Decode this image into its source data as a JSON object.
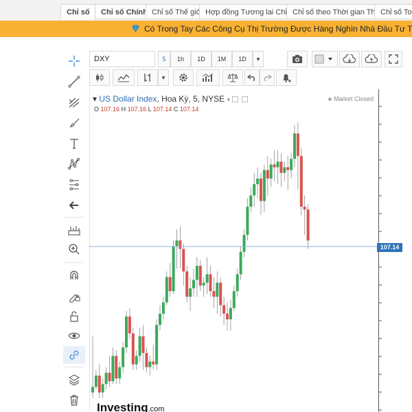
{
  "nav": {
    "tabs": [
      {
        "label": "Chỉ số"
      },
      {
        "label": "Chỉ số Chính"
      },
      {
        "label": "Chỉ số Thế giới"
      },
      {
        "label": "Hợp đồng Tương lai Chỉ số"
      },
      {
        "label": "Chỉ số theo Thời gian Thực"
      },
      {
        "label": "Chỉ số Toàn"
      }
    ]
  },
  "promo": {
    "text": "Có Trong Tay Các Công Cụ Thị Trường Được Hàng Nghìn Nhà Đầu Tư Tin Tưởng"
  },
  "toolbar": {
    "symbol": "DXY",
    "intervals": [
      "5",
      "1h",
      "1D",
      "1M",
      "1D"
    ],
    "dropdown_caret": "▾"
  },
  "left_tools": [
    {
      "icon": "crosshair-icon"
    },
    {
      "icon": "trendline-icon"
    },
    {
      "icon": "pitchfork-icon"
    },
    {
      "icon": "brush-icon"
    },
    {
      "icon": "text-icon"
    },
    {
      "icon": "pattern-icon"
    },
    {
      "icon": "fib-icon"
    },
    {
      "icon": "arrow-left-icon"
    },
    {
      "icon": "measure-icon"
    },
    {
      "icon": "zoom-in-icon"
    },
    {
      "icon": "magnet-icon"
    },
    {
      "icon": "lock-drawing-icon"
    },
    {
      "icon": "unlock-icon"
    },
    {
      "icon": "eye-icon"
    },
    {
      "icon": "link-icon"
    },
    {
      "icon": "layers-icon"
    },
    {
      "icon": "trash-icon"
    }
  ],
  "chart": {
    "symbol": "US Dollar Index",
    "details": ", Hoa Kỳ, 5, NYSE",
    "ohlc": {
      "o_label": "O",
      "o": "107.16",
      "h_label": "H",
      "h": "107.16",
      "l_label": "L",
      "l": "107.14",
      "c_label": "C",
      "c": "107.14"
    },
    "status": "Market Closed",
    "last_price": "107.14",
    "watermark": "Investing",
    "watermark_suffix": ".com",
    "colors": {
      "up": "#3aaa5c",
      "down": "#d9534f",
      "price_line": "#2e73b8"
    }
  },
  "chart_data": {
    "type": "candlestick",
    "symbol": "DXY",
    "interval": "5",
    "last_price": 107.14,
    "candles_note": "shape",
    "candles": [
      [
        0.04,
        0.24,
        0.06,
        0.02
      ],
      [
        0.06,
        0.12,
        0.1,
        0.05
      ],
      [
        0.1,
        0.14,
        0.04,
        0.02
      ],
      [
        0.04,
        0.09,
        0.07,
        0.02
      ],
      [
        0.07,
        0.13,
        0.11,
        0.05
      ],
      [
        0.11,
        0.17,
        0.08,
        0.06
      ],
      [
        0.08,
        0.2,
        0.17,
        0.07
      ],
      [
        0.17,
        0.19,
        0.09,
        0.07
      ],
      [
        0.09,
        0.15,
        0.13,
        0.07
      ],
      [
        0.13,
        0.22,
        0.2,
        0.11
      ],
      [
        0.2,
        0.33,
        0.31,
        0.18
      ],
      [
        0.31,
        0.34,
        0.25,
        0.23
      ],
      [
        0.25,
        0.27,
        0.14,
        0.12
      ],
      [
        0.14,
        0.19,
        0.17,
        0.12
      ],
      [
        0.17,
        0.27,
        0.24,
        0.15
      ],
      [
        0.24,
        0.28,
        0.18,
        0.12
      ],
      [
        0.18,
        0.2,
        0.13,
        0.11
      ],
      [
        0.13,
        0.17,
        0.15,
        0.1
      ],
      [
        0.15,
        0.21,
        0.14,
        0.12
      ],
      [
        0.14,
        0.3,
        0.28,
        0.12
      ],
      [
        0.28,
        0.35,
        0.32,
        0.26
      ],
      [
        0.32,
        0.38,
        0.36,
        0.3
      ],
      [
        0.36,
        0.47,
        0.45,
        0.35
      ],
      [
        0.45,
        0.5,
        0.4,
        0.38
      ],
      [
        0.4,
        0.58,
        0.56,
        0.39
      ],
      [
        0.56,
        0.62,
        0.58,
        0.48
      ],
      [
        0.58,
        0.63,
        0.55,
        0.48
      ],
      [
        0.55,
        0.57,
        0.47,
        0.42
      ],
      [
        0.47,
        0.49,
        0.38,
        0.36
      ],
      [
        0.38,
        0.45,
        0.41,
        0.33
      ],
      [
        0.41,
        0.48,
        0.44,
        0.38
      ],
      [
        0.44,
        0.52,
        0.49,
        0.38
      ],
      [
        0.49,
        0.51,
        0.42,
        0.4
      ],
      [
        0.42,
        0.45,
        0.43,
        0.38
      ],
      [
        0.43,
        0.52,
        0.46,
        0.39
      ],
      [
        0.46,
        0.49,
        0.4,
        0.38
      ],
      [
        0.4,
        0.45,
        0.38,
        0.34
      ],
      [
        0.38,
        0.47,
        0.43,
        0.32
      ],
      [
        0.43,
        0.45,
        0.35,
        0.31
      ],
      [
        0.35,
        0.38,
        0.32,
        0.28
      ],
      [
        0.32,
        0.36,
        0.3,
        0.26
      ],
      [
        0.3,
        0.37,
        0.34,
        0.26
      ],
      [
        0.34,
        0.42,
        0.4,
        0.33
      ],
      [
        0.4,
        0.48,
        0.46,
        0.38
      ],
      [
        0.46,
        0.56,
        0.54,
        0.44
      ],
      [
        0.54,
        0.62,
        0.6,
        0.52
      ],
      [
        0.6,
        0.73,
        0.7,
        0.58
      ],
      [
        0.7,
        0.77,
        0.74,
        0.68
      ],
      [
        0.74,
        0.82,
        0.78,
        0.7
      ],
      [
        0.78,
        0.84,
        0.8,
        0.73
      ],
      [
        0.8,
        0.82,
        0.72,
        0.67
      ],
      [
        0.72,
        0.85,
        0.83,
        0.68
      ],
      [
        0.83,
        0.88,
        0.8,
        0.74
      ],
      [
        0.8,
        0.87,
        0.85,
        0.77
      ],
      [
        0.85,
        0.9,
        0.84,
        0.79
      ],
      [
        0.84,
        0.9,
        0.86,
        0.78
      ],
      [
        0.86,
        0.89,
        0.82,
        0.77
      ],
      [
        0.82,
        0.86,
        0.84,
        0.79
      ],
      [
        0.84,
        0.88,
        0.83,
        0.76
      ],
      [
        0.83,
        0.89,
        0.87,
        0.8
      ],
      [
        0.87,
        0.99,
        0.96,
        0.84
      ],
      [
        0.96,
        1.0,
        0.88,
        0.76
      ],
      [
        0.88,
        0.91,
        0.7,
        0.67
      ],
      [
        0.7,
        0.74,
        0.69,
        0.6
      ],
      [
        0.69,
        0.71,
        0.58,
        0.55
      ]
    ]
  }
}
